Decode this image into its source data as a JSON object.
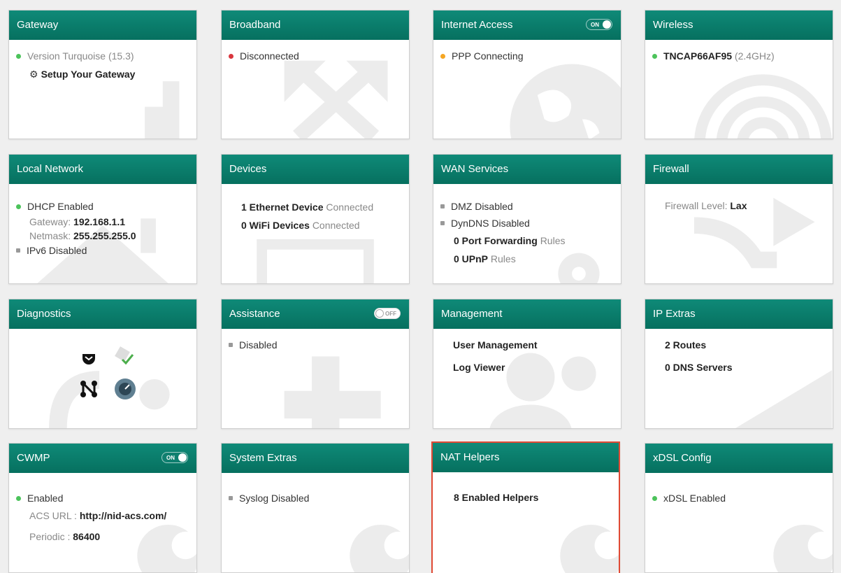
{
  "cards": {
    "gateway": {
      "title": "Gateway",
      "version": "Version Turquoise (15.3)",
      "setup_label": "Setup Your Gateway"
    },
    "broadband": {
      "title": "Broadband",
      "status": "Disconnected"
    },
    "internet": {
      "title": "Internet Access",
      "toggle": "ON",
      "status": "PPP Connecting"
    },
    "wireless": {
      "title": "Wireless",
      "ssid": "TNCAP66AF95",
      "band": "(2.4GHz)"
    },
    "local_network": {
      "title": "Local Network",
      "dhcp": "DHCP Enabled",
      "gateway_label": "Gateway:",
      "gateway_value": "192.168.1.1",
      "netmask_label": "Netmask:",
      "netmask_value": "255.255.255.0",
      "ipv6": "IPv6 Disabled"
    },
    "devices": {
      "title": "Devices",
      "eth_count": "1 Ethernet Device",
      "eth_suffix": "Connected",
      "wifi_count": "0 WiFi Devices",
      "wifi_suffix": "Connected"
    },
    "wan": {
      "title": "WAN Services",
      "dmz": "DMZ Disabled",
      "dyndns": "DynDNS Disabled",
      "pf_count": "0 Port Forwarding",
      "pf_suffix": "Rules",
      "upnp_count": "0 UPnP",
      "upnp_suffix": "Rules"
    },
    "firewall": {
      "title": "Firewall",
      "level_label": "Firewall Level:",
      "level_value": "Lax"
    },
    "diagnostics": {
      "title": "Diagnostics"
    },
    "assistance": {
      "title": "Assistance",
      "toggle": "OFF",
      "status": "Disabled"
    },
    "management": {
      "title": "Management",
      "user_mgmt": "User Management",
      "log_viewer": "Log Viewer"
    },
    "ip_extras": {
      "title": "IP Extras",
      "routes": "2 Routes",
      "dns": "0 DNS Servers"
    },
    "cwmp": {
      "title": "CWMP",
      "toggle": "ON",
      "status": "Enabled",
      "acs_label": "ACS URL :",
      "acs_value": "http://nid-acs.com/",
      "periodic_label": "Periodic :",
      "periodic_value": "86400"
    },
    "system_extras": {
      "title": "System Extras",
      "syslog": "Syslog Disabled"
    },
    "nat": {
      "title": "NAT Helpers",
      "helpers": "8 Enabled Helpers"
    },
    "xdsl": {
      "title": "xDSL Config",
      "status": "xDSL Enabled"
    }
  },
  "colors": {
    "header": "#0a7d6c",
    "green": "#4cc35b",
    "red": "#d9363e",
    "orange": "#f5a623",
    "gray": "#999999",
    "selected_border": "#e04a34"
  },
  "icons": {
    "gateway_bg": "info-icon",
    "broadband_bg": "expand-arrows-icon",
    "internet_bg": "globe-icon",
    "wireless_bg": "wifi-signal-icon",
    "local_bg": "house-icon",
    "devices_bg": "desktop-icon",
    "wan_bg": "cogs-icon",
    "firewall_bg": "shuffle-icon",
    "diag_bg": "stethoscope-icon",
    "assist_bg": "plus-icon",
    "mgmt_bg": "users-icon",
    "ipx_bg": "chart-icon",
    "wrench_bg": "wrench-icon"
  }
}
